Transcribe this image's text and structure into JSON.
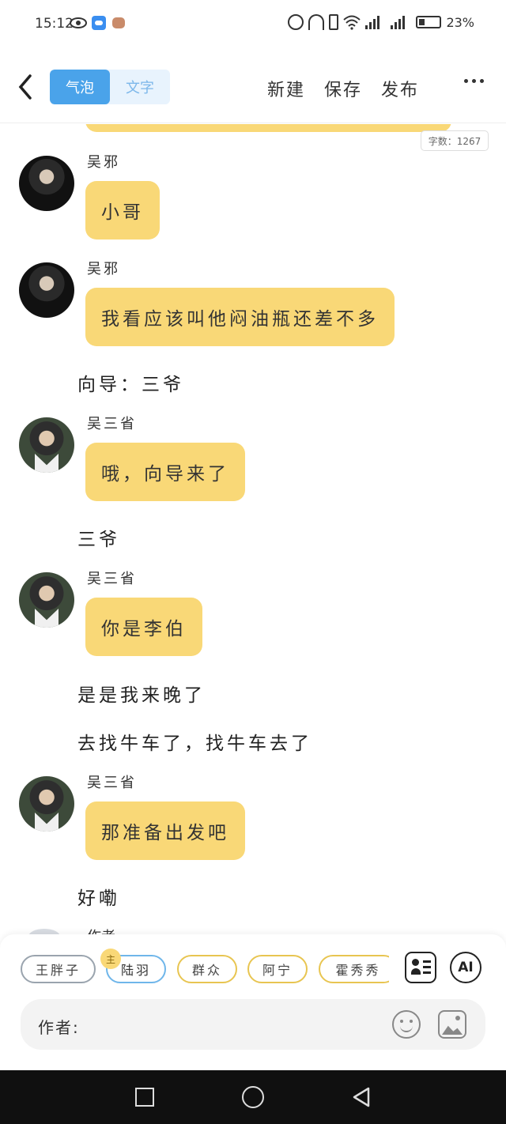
{
  "status_bar": {
    "time": "15:12",
    "battery_percent": "23%",
    "icons": [
      "eye-icon",
      "cloud-icon",
      "pet-icon",
      "alarm-icon",
      "headphones-icon",
      "vibrate-icon",
      "wifi-icon",
      "signal-4g-icon",
      "signal-4g-icon",
      "battery-icon"
    ]
  },
  "header": {
    "back_icon": "chevron-left-icon",
    "tabs": [
      {
        "label": "气泡",
        "active": true
      },
      {
        "label": "文字",
        "active": false
      }
    ],
    "actions": [
      "新建",
      "保存",
      "发布"
    ],
    "more_icon": "more-dots-icon"
  },
  "word_count": "字数：1267",
  "messages": [
    {
      "type": "bubble",
      "sender": "吴邪",
      "text": "小哥"
    },
    {
      "type": "bubble",
      "sender": "吴邪",
      "text": "我看应该叫他闷油瓶还差不多"
    },
    {
      "type": "plain",
      "text": "向导：三爷"
    },
    {
      "type": "bubble",
      "sender": "吴三省",
      "text": "哦，向导来了"
    },
    {
      "type": "plain",
      "text": "三爷"
    },
    {
      "type": "bubble",
      "sender": "吴三省",
      "text": "你是李伯"
    },
    {
      "type": "plain",
      "text": "是是我来晚了"
    },
    {
      "type": "plain",
      "text": "去找牛车了，找牛车去了"
    },
    {
      "type": "bubble",
      "sender": "吴三省",
      "text": "那准备出发吧"
    },
    {
      "type": "plain",
      "text": "好嘞"
    }
  ],
  "partial_sender": "作者",
  "characters": [
    {
      "name": "王胖子",
      "style": "gray"
    },
    {
      "name": "陆羽",
      "style": "blue",
      "badge": "主"
    },
    {
      "name": "群众",
      "style": "yellow"
    },
    {
      "name": "阿宁",
      "style": "yellow"
    },
    {
      "name": "霍秀秀",
      "style": "yellow"
    }
  ],
  "tools": {
    "role_icon": "contact-card-icon",
    "ai_label": "AI"
  },
  "input": {
    "label": "作者:",
    "emoji_icon": "smile-icon",
    "image_icon": "image-icon"
  },
  "colors": {
    "bubble": "#f9d877",
    "accent_blue": "#4aa3ea",
    "nav_bg": "#101010"
  }
}
